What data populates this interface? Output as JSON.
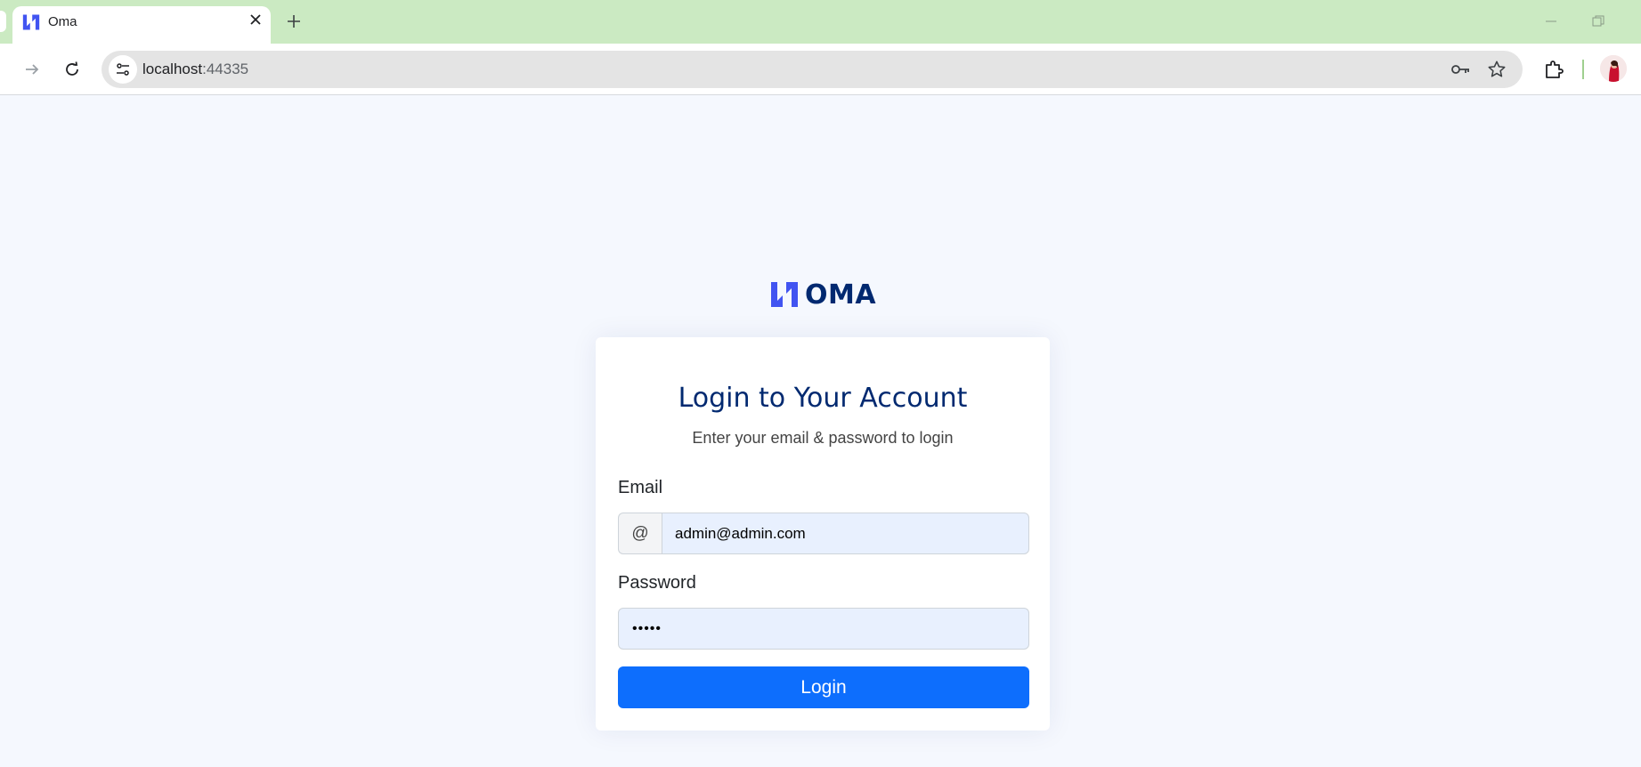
{
  "browser": {
    "tab": {
      "title": "Oma"
    },
    "address_bar": {
      "host": "localhost",
      "port": ":44335"
    },
    "icons": {
      "favicon": "oma-logo-icon",
      "close_tab": "close-icon",
      "new_tab": "plus-icon",
      "forward": "arrow-right-icon",
      "reload": "reload-icon",
      "site_info": "tune-icon",
      "password": "key-icon",
      "bookmark": "star-icon",
      "extensions": "puzzle-icon",
      "profile": "avatar"
    }
  },
  "brand": {
    "name": "OMA",
    "colors": {
      "primary": "#012970",
      "accent": "#4154f1",
      "button": "#0d6efd",
      "tab_strip": "#cbeac2",
      "page_bg": "#f5f8fe"
    }
  },
  "login": {
    "title": "Login to Your Account",
    "subtitle": "Enter your email & password to login",
    "email": {
      "label": "Email",
      "prefix": "@",
      "value": "admin@admin.com"
    },
    "password": {
      "label": "Password",
      "masked_value": "•••••"
    },
    "submit_label": "Login"
  }
}
